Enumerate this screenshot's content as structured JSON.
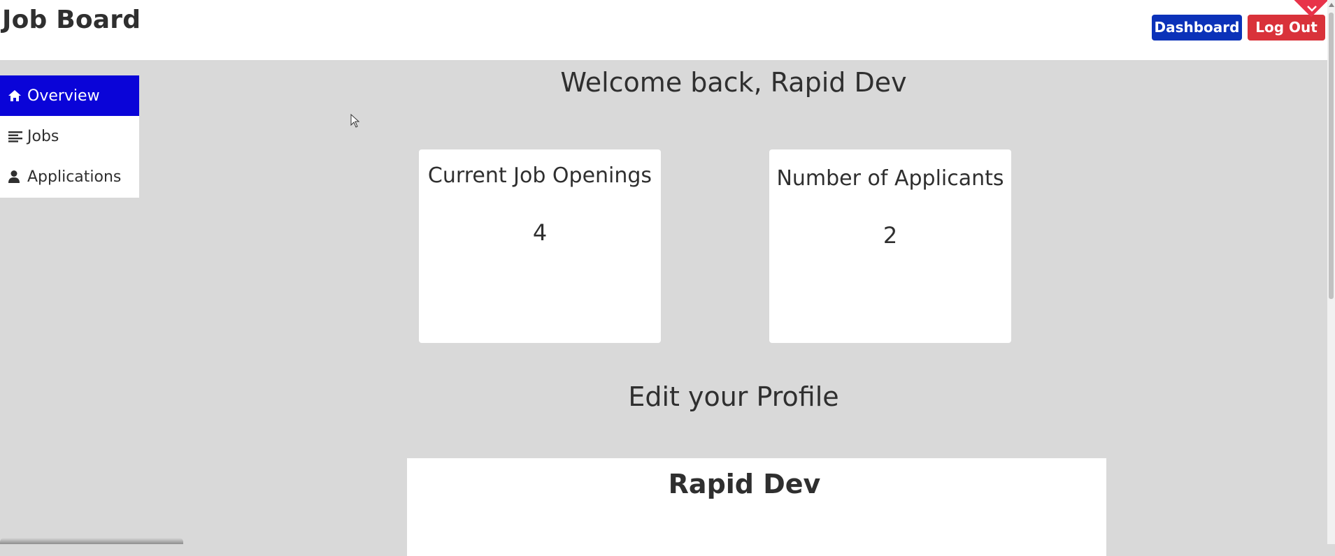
{
  "header": {
    "brand": "Job Board",
    "dashboard_label": "Dashboard",
    "logout_label": "Log Out"
  },
  "sidebar": {
    "items": [
      {
        "label": "Overview",
        "icon": "home-icon",
        "active": true
      },
      {
        "label": "Jobs",
        "icon": "list-icon",
        "active": false
      },
      {
        "label": "Applications",
        "icon": "user-icon",
        "active": false
      }
    ]
  },
  "main": {
    "welcome": "Welcome back, Rapid Dev",
    "cards": [
      {
        "title": "Current Job Openings",
        "value": "4"
      },
      {
        "title": "Number of Applicants",
        "value": "2"
      }
    ],
    "profile_heading": "Edit your Profile",
    "profile_name": "Rapid Dev"
  },
  "colors": {
    "accent_blue": "#0a04d8",
    "dashboard_button": "#0b32b9",
    "logout_button": "#d9323a",
    "background": "#d9d9d9"
  }
}
